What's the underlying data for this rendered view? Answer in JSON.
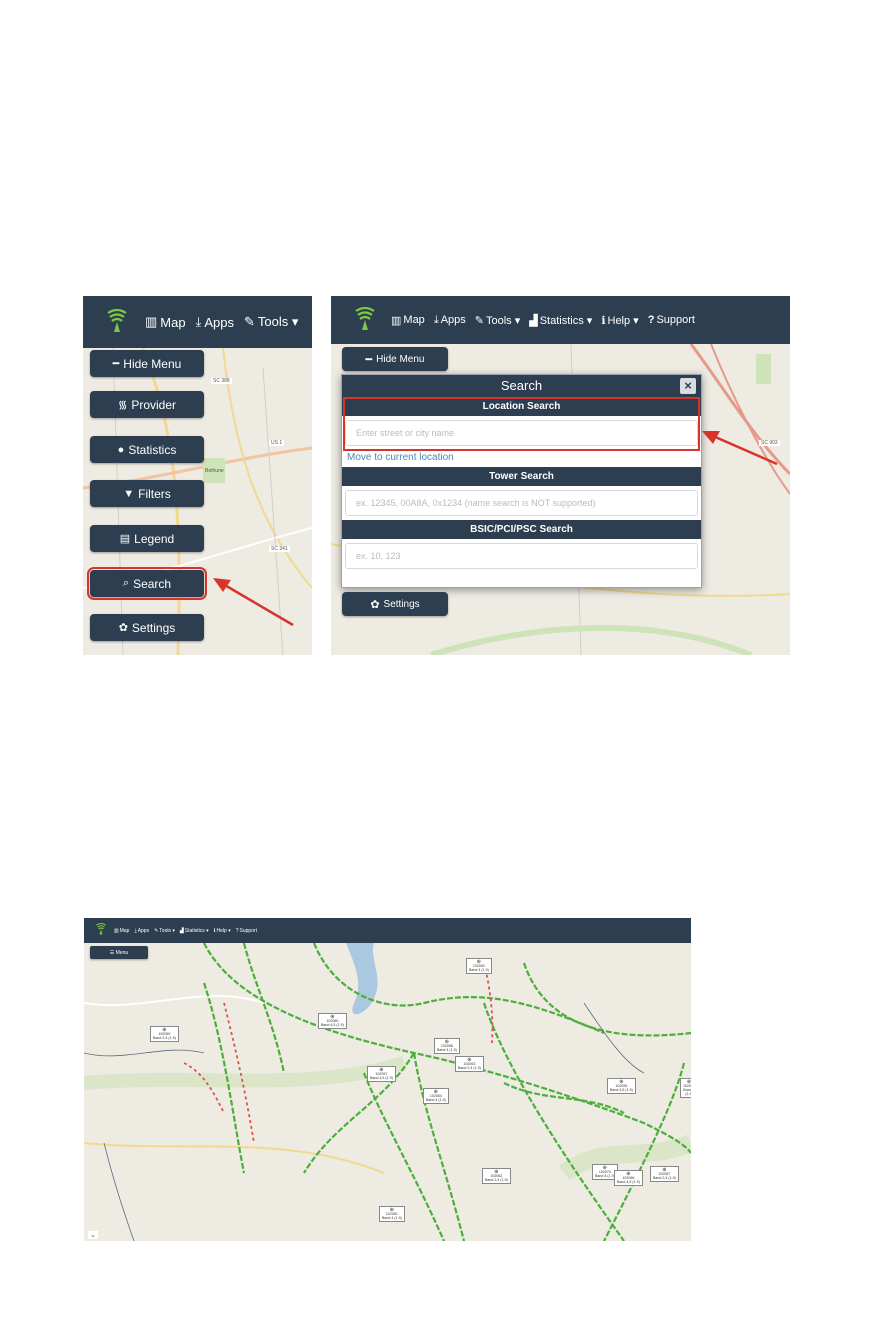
{
  "left_shot": {
    "nav": [
      {
        "icon": "map-icon",
        "glyph": "▥",
        "label": "Map"
      },
      {
        "icon": "download-icon",
        "glyph": "⤓",
        "label": "Apps"
      },
      {
        "icon": "wrench-icon",
        "glyph": "✎",
        "label": "Tools ▾"
      }
    ],
    "menu": {
      "hide_menu": "Hide Menu",
      "provider": "Provider",
      "statistics": "Statistics",
      "filters": "Filters",
      "legend": "Legend",
      "search": "Search",
      "settings": "Settings"
    },
    "map_labels": [
      "SC 388",
      "US 1",
      "SC 341",
      "Bethune"
    ]
  },
  "right_shot": {
    "nav": [
      {
        "icon": "map-icon",
        "glyph": "▥",
        "label": "Map"
      },
      {
        "icon": "download-icon",
        "glyph": "⤓",
        "label": "Apps"
      },
      {
        "icon": "wrench-icon",
        "glyph": "✎",
        "label": "Tools ▾"
      },
      {
        "icon": "bar-chart-icon",
        "glyph": "▟",
        "label": "Statistics ▾"
      },
      {
        "icon": "info-icon",
        "glyph": "ℹ",
        "label": "Help ▾"
      },
      {
        "icon": "question-icon",
        "glyph": "?",
        "label": "Support"
      }
    ],
    "hide_menu": "Hide Menu",
    "settings": "Settings",
    "map_labels": [
      "SC 903"
    ],
    "search_panel": {
      "title": "Search",
      "close": "×",
      "location_head": "Location Search",
      "location_placeholder": "Enter street or city name",
      "current_location_link": "Move to current location",
      "tower_head": "Tower Search",
      "tower_placeholder": "ex. 12345, 00A8A, 0x1234 (name search is NOT supported)",
      "bsic_head": "BSIC/PCI/PSC Search",
      "bsic_placeholder": "ex. 10, 123"
    }
  },
  "bottom_shot": {
    "nav": [
      {
        "icon": "map-icon",
        "glyph": "▥",
        "label": "Map"
      },
      {
        "icon": "download-icon",
        "glyph": "⤓",
        "label": "Apps"
      },
      {
        "icon": "wrench-icon",
        "glyph": "✎",
        "label": "Tools ▾"
      },
      {
        "icon": "bar-chart-icon",
        "glyph": "▟",
        "label": "Statistics ▾"
      },
      {
        "icon": "info-icon",
        "glyph": "ℹ",
        "label": "Help ▾"
      },
      {
        "icon": "question-icon",
        "glyph": "?",
        "label": "Support"
      }
    ],
    "menu_button": "☰ Menu",
    "towers": [
      {
        "id": "102052",
        "info": "Band 4 (1.9)"
      },
      {
        "id": "102060",
        "info": "Band 4,5 (1.9)"
      },
      {
        "id": "102059",
        "info": "Band 2,4 (1.9)"
      },
      {
        "id": "102058",
        "info": "Band 4 (1.9)"
      },
      {
        "id": "102063",
        "info": "Band 2,4 (1.9)"
      },
      {
        "id": "102057",
        "info": "Band 4,5 (1.9)"
      },
      {
        "id": "102054",
        "info": "Band 4 (1.9)"
      },
      {
        "id": "102055",
        "info": "Band 4,5 (1.9)"
      },
      {
        "id": "102064",
        "info": "Band 4 (1.9)"
      },
      {
        "id": "102062",
        "info": "Band 2,4 (1.9)"
      },
      {
        "id": "102061",
        "info": "Band 4 (1.9)"
      },
      {
        "id": "102070",
        "info": "Band 4 (1.9)"
      },
      {
        "id": "102066",
        "info": "Band 4,5 (1.9)"
      },
      {
        "id": "102067",
        "info": "Band 2,4 (1.9)"
      }
    ]
  },
  "colors": {
    "navbar": "#2c3e50",
    "highlight": "#d9342b",
    "map": "#eeebe3",
    "coverage": "#4caf3c",
    "weak": "#d9534f",
    "water": "#aac8e0"
  }
}
